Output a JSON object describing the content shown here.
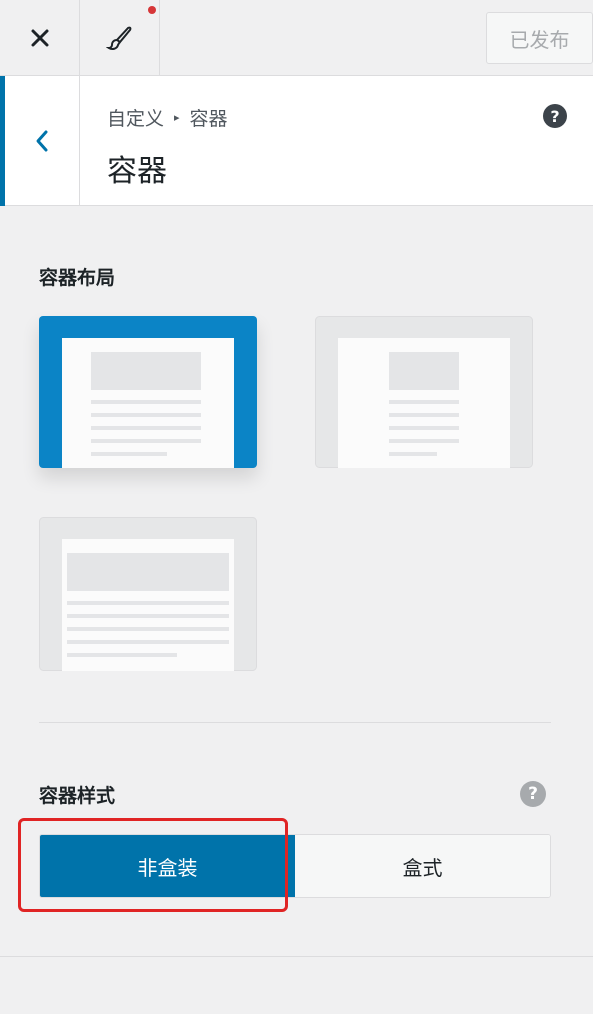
{
  "toolbar": {
    "close_icon": "close-icon",
    "brush_icon": "paintbrush-icon",
    "published_label": "已发布"
  },
  "header": {
    "breadcrumb_root": "自定义",
    "breadcrumb_sep": "▸",
    "breadcrumb_current": "容器",
    "title": "容器",
    "help": "?"
  },
  "layout": {
    "label": "容器布局",
    "options": [
      {
        "name": "contained",
        "selected": true
      },
      {
        "name": "contained-narrow",
        "selected": false
      },
      {
        "name": "full-width",
        "selected": false
      }
    ]
  },
  "style": {
    "label": "容器样式",
    "help": "?",
    "options": [
      "非盒装",
      "盒式"
    ],
    "selected": "非盒装"
  },
  "colors": {
    "accent": "#0073aa",
    "highlight": "#e02424",
    "notification": "#d63638"
  }
}
